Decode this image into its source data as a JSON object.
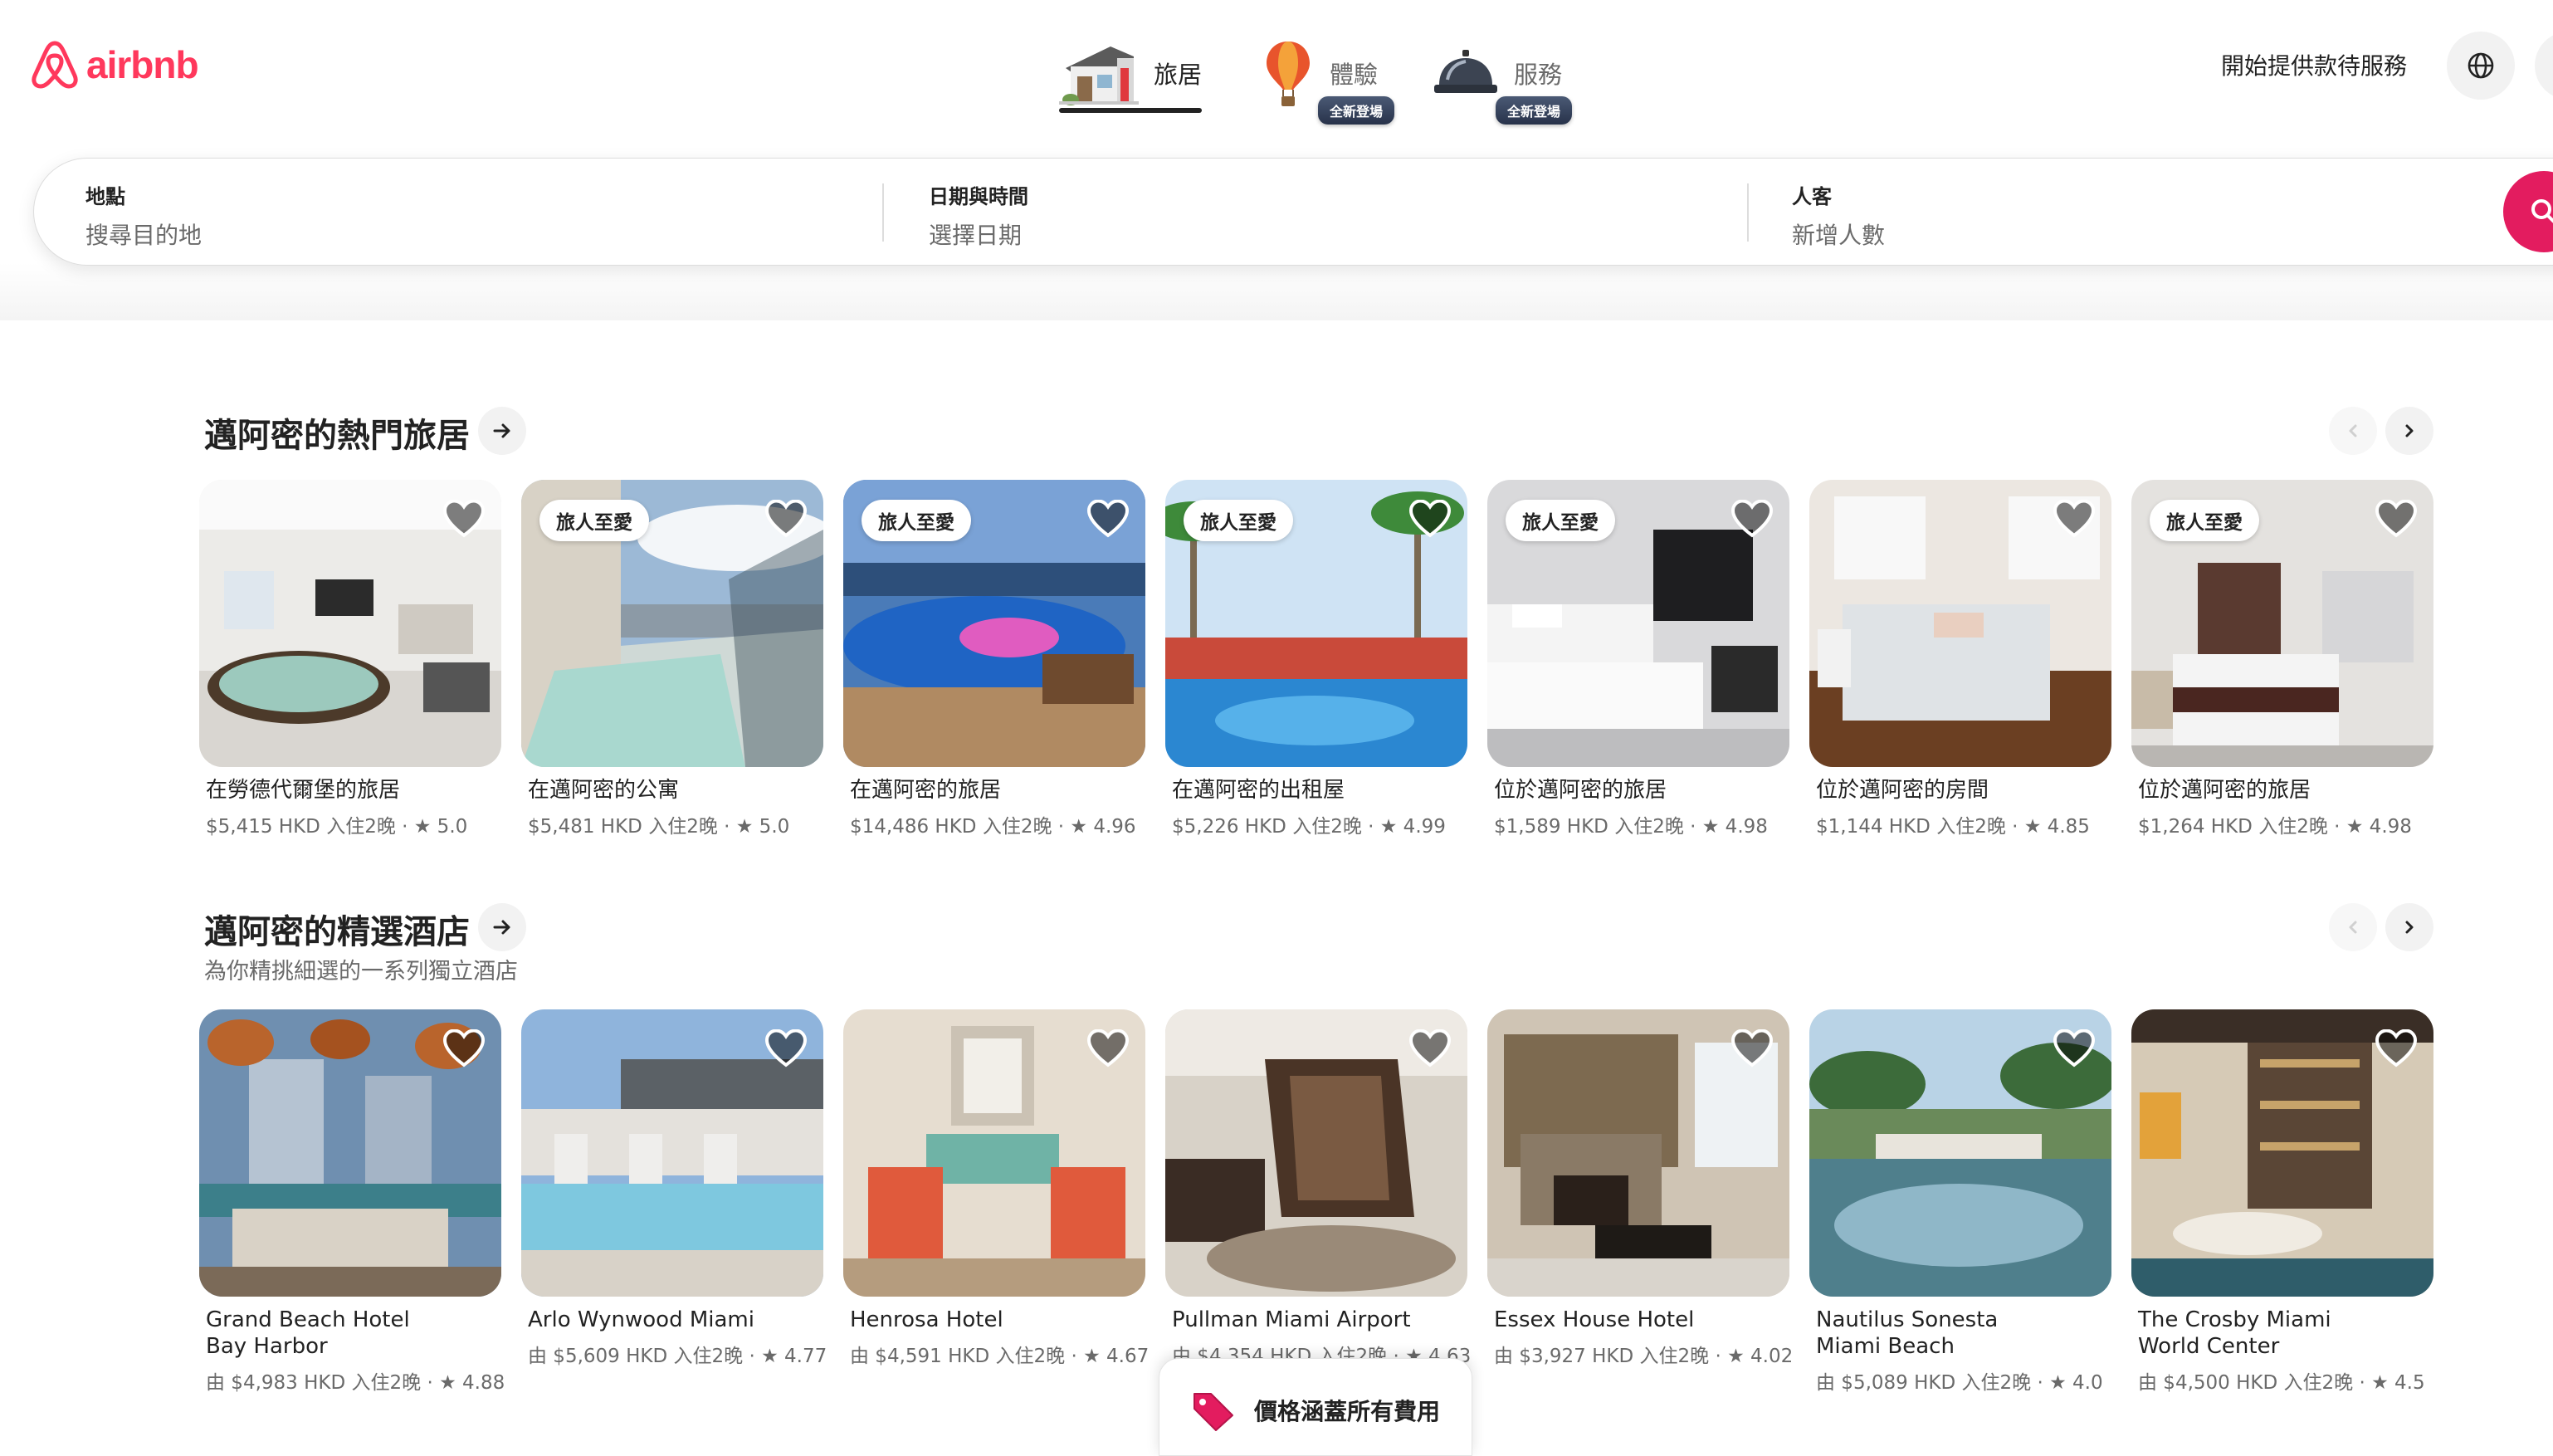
{
  "header": {
    "logo_text": "airbnb",
    "tabs": [
      {
        "label": "旅居",
        "active": true,
        "icon": "house-icon"
      },
      {
        "label": "體驗",
        "active": false,
        "icon": "hot-air-balloon-icon",
        "badge": "全新登場"
      },
      {
        "label": "服務",
        "active": false,
        "icon": "service-bell-icon",
        "badge": "全新登場"
      }
    ],
    "host_link": "開始提供款待服務",
    "language_icon": "globe-icon"
  },
  "search": {
    "location_label": "地點",
    "location_placeholder": "搜尋目的地",
    "dates_label": "日期與時間",
    "dates_placeholder": "選擇日期",
    "guests_label": "人客",
    "guests_placeholder": "新增人數"
  },
  "sections": [
    {
      "title": "邁阿密的熱門旅居",
      "listings": [
        {
          "title": "在勞德代爾堡的旅居",
          "meta": "$5,415 HKD 入住2晚 · ★ 5.0",
          "badge": ""
        },
        {
          "title": "在邁阿密的公寓",
          "meta": "$5,481 HKD 入住2晚 · ★ 5.0",
          "badge": "旅人至愛"
        },
        {
          "title": "在邁阿密的旅居",
          "meta": "$14,486 HKD 入住2晚 · ★ 4.96",
          "badge": "旅人至愛"
        },
        {
          "title": "在邁阿密的出租屋",
          "meta": "$5,226 HKD 入住2晚 · ★ 4.99",
          "badge": "旅人至愛"
        },
        {
          "title": "位於邁阿密的旅居",
          "meta": "$1,589 HKD 入住2晚 · ★ 4.98",
          "badge": "旅人至愛"
        },
        {
          "title": "位於邁阿密的房間",
          "meta": "$1,144 HKD 入住2晚 · ★ 4.85",
          "badge": ""
        },
        {
          "title": "位於邁阿密的旅居",
          "meta": "$1,264 HKD 入住2晚 · ★ 4.98",
          "badge": "旅人至愛"
        }
      ]
    },
    {
      "title": "邁阿密的精選酒店",
      "subtitle": "為你精挑細選的一系列獨立酒店",
      "listings": [
        {
          "title_line1": "Grand Beach Hotel",
          "title_line2": "Bay Harbor",
          "meta": "由 $4,983 HKD 入住2晚 · ★ 4.88"
        },
        {
          "title_line1": "Arlo Wynwood Miami",
          "title_line2": "",
          "meta": "由 $5,609 HKD 入住2晚 · ★ 4.77"
        },
        {
          "title_line1": "Henrosa Hotel",
          "title_line2": "",
          "meta": "由 $4,591 HKD 入住2晚 · ★ 4.67"
        },
        {
          "title_line1": "Pullman Miami Airport",
          "title_line2": "",
          "meta": "由 $4,354 HKD 入住2晚 · ★ 4.63"
        },
        {
          "title_line1": "Essex House Hotel",
          "title_line2": "",
          "meta": "由 $3,927 HKD 入住2晚 · ★ 4.02"
        },
        {
          "title_line1": "Nautilus Sonesta",
          "title_line2": "Miami Beach",
          "meta": "由 $5,089 HKD 入住2晚 · ★ 4.0"
        },
        {
          "title_line1": "The Crosby Miami",
          "title_line2": "World Center",
          "meta": "由 $4,500 HKD 入住2晚 · ★ 4.5"
        }
      ]
    }
  ],
  "price_notice": "價格涵蓋所有費用",
  "colors": {
    "brand": "#ff385c",
    "search_button": "#e31c5f",
    "text": "#222222",
    "muted": "#6a6a6a"
  }
}
